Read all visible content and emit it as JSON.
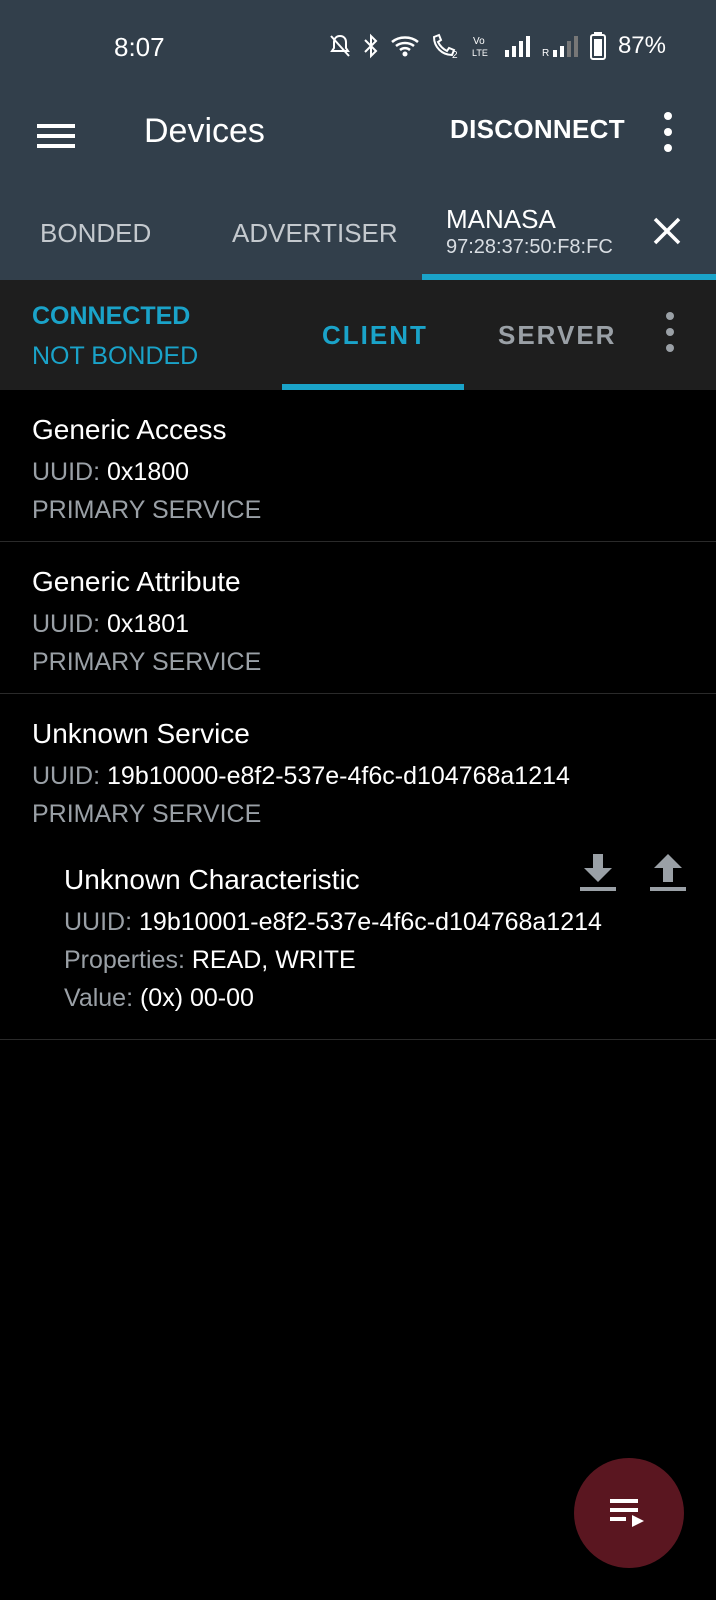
{
  "status_bar": {
    "time": "8:07",
    "battery": "87%",
    "icons": [
      "mute-icon",
      "bluetooth-icon",
      "wifi-icon",
      "wifi-call-icon",
      "volte-icon",
      "signal-icon",
      "signal-roaming-icon",
      "battery-icon"
    ]
  },
  "app_bar": {
    "title": "Devices",
    "disconnect_label": "DISCONNECT"
  },
  "device_tabs": {
    "bonded": "BONDED",
    "advertiser": "ADVERTISER",
    "device_name": "MANASA",
    "device_address": "97:28:37:50:F8:FC"
  },
  "connection": {
    "state": "CONNECTED",
    "bond_state": "NOT BONDED",
    "tab_client": "CLIENT",
    "tab_server": "SERVER"
  },
  "labels": {
    "uuid": "UUID:",
    "properties": "Properties:",
    "value": "Value:"
  },
  "services": [
    {
      "name": "Generic Access",
      "uuid": "0x1800",
      "type": "PRIMARY SERVICE"
    },
    {
      "name": "Generic Attribute",
      "uuid": "0x1801",
      "type": "PRIMARY SERVICE"
    },
    {
      "name": "Unknown Service",
      "uuid": "19b10000-e8f2-537e-4f6c-d104768a1214",
      "type": "PRIMARY SERVICE"
    }
  ],
  "characteristic": {
    "name": "Unknown Characteristic",
    "uuid": "19b10001-e8f2-537e-4f6c-d104768a1214",
    "properties": "READ, WRITE",
    "value": "(0x) 00-00"
  },
  "colors": {
    "accent": "#1aa3c9",
    "app_bar": "#323f4b",
    "connection_bar": "#1e1e1e",
    "fab": "#5a1620"
  }
}
